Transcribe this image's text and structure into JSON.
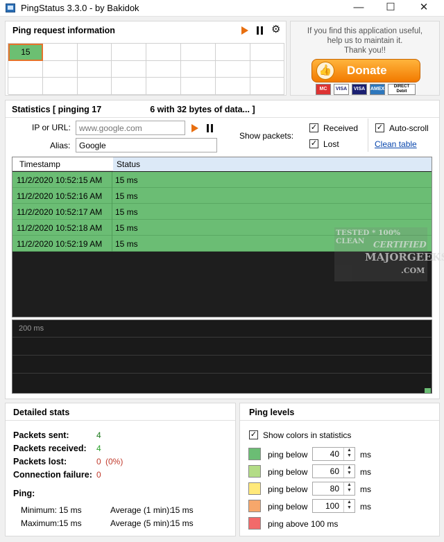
{
  "window": {
    "title": "PingStatus 3.3.0 - by Bakidok",
    "controls": {
      "minimize": "—",
      "maximize": "☐",
      "close": "✕"
    }
  },
  "ping_request": {
    "title": "Ping request information",
    "cells": [
      "15"
    ]
  },
  "donate": {
    "line1": "If you find this application useful,",
    "line2": "help us to maintain it.",
    "line3": "Thank you!!",
    "button_label": "Donate",
    "cards": [
      "MC",
      "VISA",
      "VISA",
      "AMEX",
      "DIRECT Debit"
    ]
  },
  "statistics": {
    "title": "Statistics  [ pinging 17",
    "title_tail": "6 with 32 bytes of data... ]",
    "ip_label": "IP or URL:",
    "ip_placeholder": "www.google.com",
    "alias_label": "Alias:",
    "alias_value": "Google",
    "show_packets_label": "Show packets:",
    "received_label": "Received",
    "lost_label": "Lost",
    "autoscroll_label": "Auto-scroll",
    "clean_table_label": "Clean table"
  },
  "table": {
    "headers": [
      "Timestamp",
      "Status"
    ],
    "rows": [
      [
        "11/2/2020  10:52:15 AM",
        "15 ms"
      ],
      [
        "11/2/2020  10:52:16 AM",
        "15 ms"
      ],
      [
        "11/2/2020  10:52:17 AM",
        "15 ms"
      ],
      [
        "11/2/2020  10:52:18 AM",
        "15 ms"
      ],
      [
        "11/2/2020  10:52:19 AM",
        "15 ms"
      ]
    ]
  },
  "graph": {
    "label": "200 ms"
  },
  "watermark": {
    "line1": "TESTED * 100% CLEAN",
    "line2": "CERTIFIED",
    "line3": "MAJORGEEKS",
    "line4": ".COM"
  },
  "detailed": {
    "title": "Detailed stats",
    "sent_label": "Packets sent:",
    "sent_value": "4",
    "received_label": "Packets received:",
    "received_value": "4",
    "lost_label": "Packets lost:",
    "lost_value": "0",
    "lost_pct": "(0%)",
    "failure_label": "Connection failure:",
    "failure_value": "0",
    "ping_label": "Ping:",
    "min_label": "Minimum:",
    "min_value": "15 ms",
    "max_label": "Maximum:",
    "max_value": "15 ms",
    "avg1_label": "Average (1 min):",
    "avg1_value": "15 ms",
    "avg5_label": "Average (5 min):",
    "avg5_value": "15 ms"
  },
  "levels": {
    "title": "Ping levels",
    "show_colors_label": "Show colors in statistics",
    "items": [
      {
        "label": "ping below",
        "value": "40",
        "unit": "ms",
        "color": "#6bbd74"
      },
      {
        "label": "ping below",
        "value": "60",
        "unit": "ms",
        "color": "#b3dc86"
      },
      {
        "label": "ping below",
        "value": "80",
        "unit": "ms",
        "color": "#ffe97a"
      },
      {
        "label": "ping below",
        "value": "100",
        "unit": "ms",
        "color": "#f7a76b"
      }
    ],
    "above_label": "ping above 100 ms",
    "above_color": "#f26a6a"
  }
}
